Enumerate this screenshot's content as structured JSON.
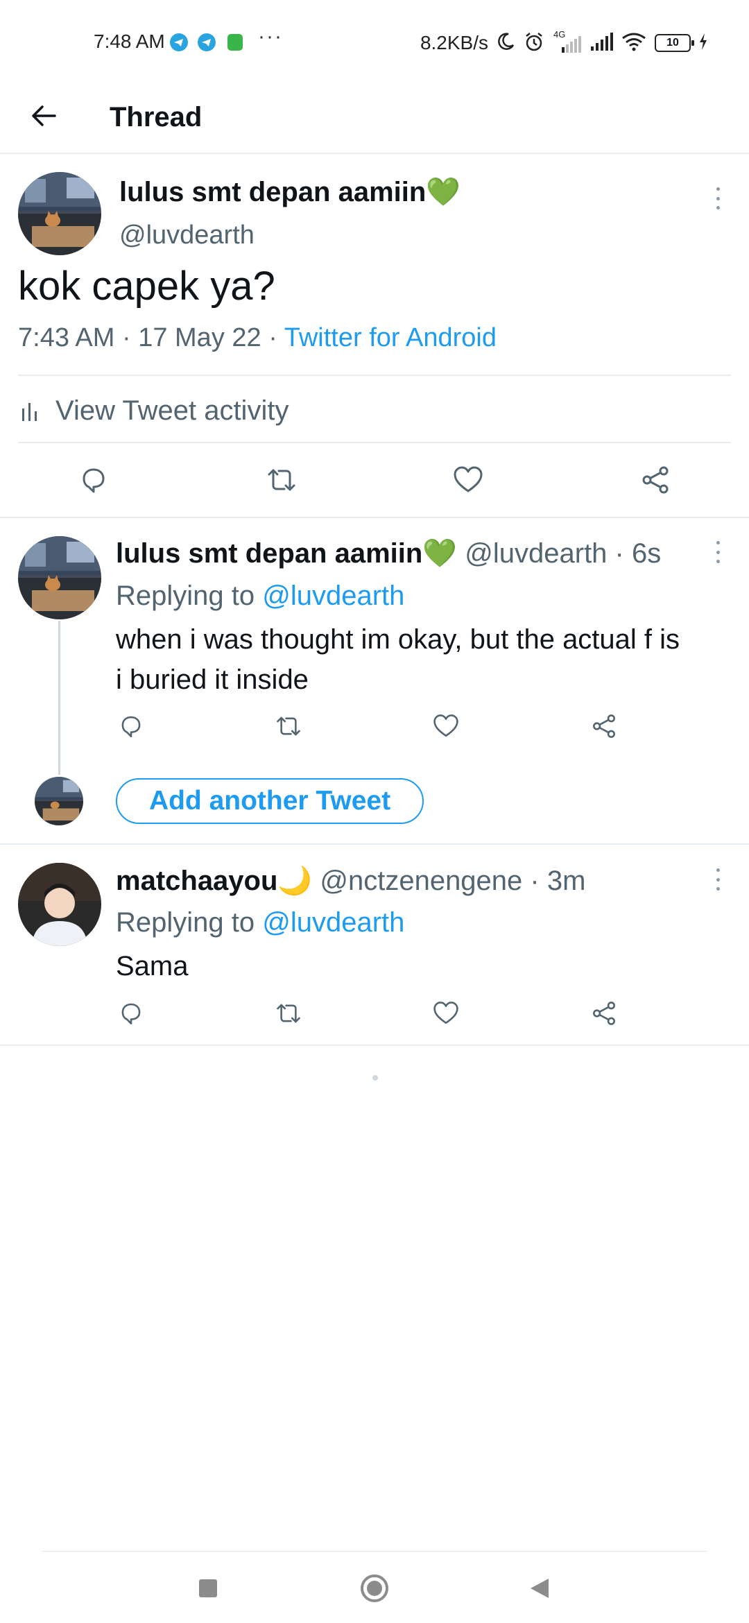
{
  "status_bar": {
    "time": "7:48 AM",
    "net_speed": "8.2KB/s",
    "network_type": "4G",
    "battery_level": "10",
    "overflow": "···",
    "icons": [
      "telegram-icon",
      "telegram-icon",
      "android-icon",
      "moon-icon",
      "alarm-icon",
      "signal-icon",
      "signal-icon",
      "wifi-icon",
      "battery-icon",
      "charging-icon"
    ]
  },
  "header": {
    "title": "Thread"
  },
  "main_tweet": {
    "author_name": "lulus smt depan aamiin💚",
    "author_handle": "@luvdearth",
    "text": "kok capek ya?",
    "time": "7:43 AM",
    "date": "17 May 22",
    "separator": "·",
    "source": "Twitter for Android",
    "activity_label": "View Tweet activity"
  },
  "reply_self": {
    "author_name": "lulus smt depan aamiin💚",
    "author_handle": "@luvdearth",
    "separator": "·",
    "age": "6s",
    "replying_prefix": "Replying to",
    "replying_to": "@luvdearth",
    "text_line1": "when i was thought im okay, but the actual f is",
    "text_line2": "i buried it inside"
  },
  "add_tweet": {
    "label": "Add another Tweet"
  },
  "reply_other": {
    "author_name": "matchaayou🌙",
    "author_handle": "@nctzenengene",
    "separator": "·",
    "age": "3m",
    "replying_prefix": "Replying to",
    "replying_to": "@luvdearth",
    "text": "Sama"
  },
  "colors": {
    "accent": "#1d9bf0",
    "text_primary": "#0f1419",
    "text_secondary": "#536471",
    "divider": "#e6ecf0"
  }
}
